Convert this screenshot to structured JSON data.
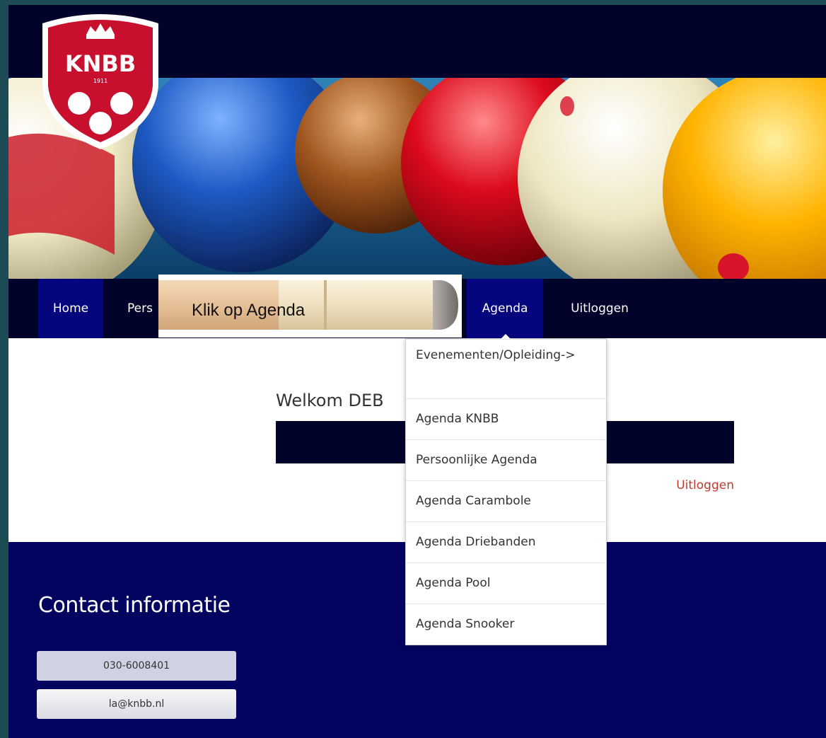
{
  "logo": {
    "alt": "KNBB",
    "text": "KNBB",
    "year": "1911"
  },
  "nav": {
    "items": [
      {
        "label": "Home"
      },
      {
        "label": "Pers"
      },
      {
        "label": "Agenda"
      },
      {
        "label": "Uitloggen"
      }
    ]
  },
  "tooltip": {
    "text": "Klik op Agenda"
  },
  "main": {
    "welcome": "Welkom DEB",
    "logout": "Uitloggen"
  },
  "dropdown": {
    "items": [
      {
        "label": "Evenementen/Opleiding->"
      },
      {
        "label": "Agenda KNBB"
      },
      {
        "label": "Persoonlijke Agenda"
      },
      {
        "label": "Agenda Carambole"
      },
      {
        "label": "Agenda Driebanden"
      },
      {
        "label": "Agenda Pool"
      },
      {
        "label": "Agenda Snooker"
      }
    ]
  },
  "footer": {
    "title": "Contact informatie",
    "phone": "030-6008401",
    "email": "la@knbb.nl"
  },
  "colors": {
    "navy": "#02032a",
    "footer_blue": "#02045f",
    "active_nav": "#05057e",
    "logo_red": "#c8102e",
    "link_red": "#c0392b"
  }
}
